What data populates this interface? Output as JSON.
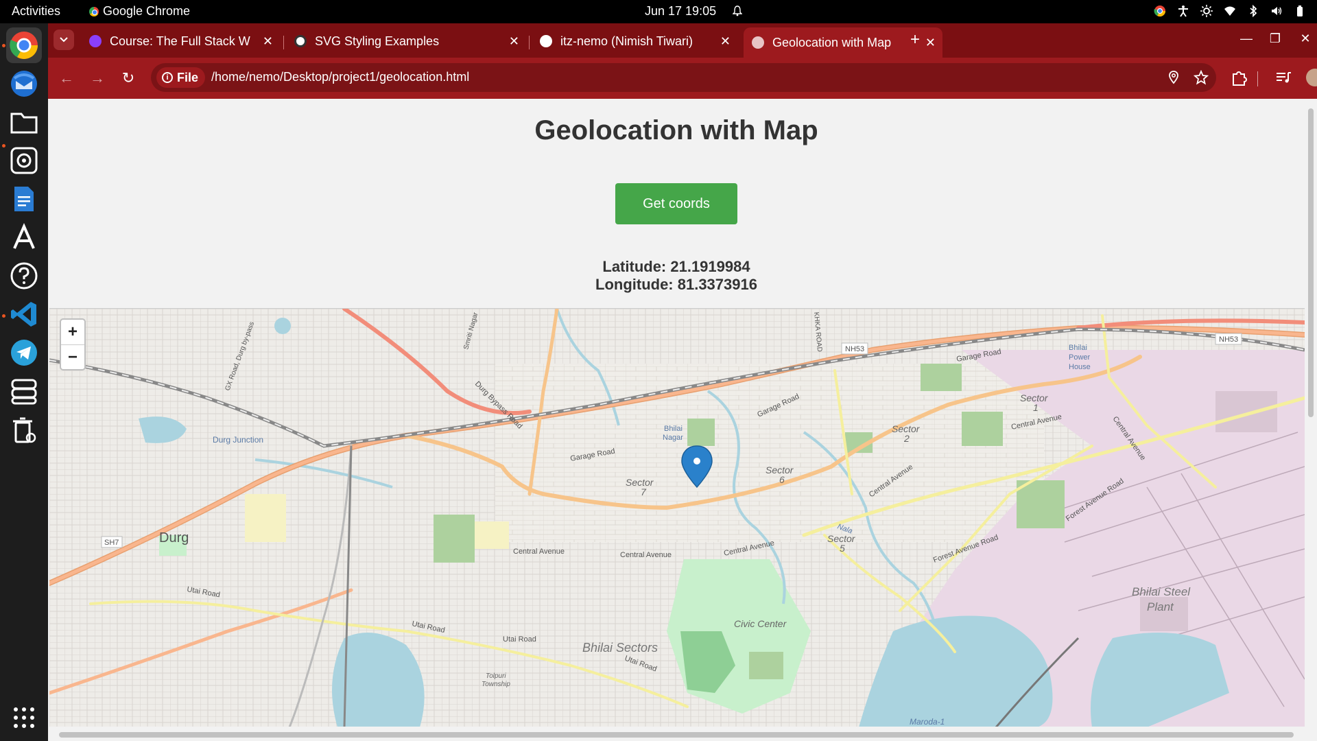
{
  "system": {
    "activities": "Activities",
    "app_name": "Google Chrome",
    "clock": "Jun 17  19:05"
  },
  "dock": {
    "items": [
      "google-chrome",
      "thunderbird",
      "files",
      "rhythmbox",
      "libreoffice-writer",
      "app-center",
      "help",
      "vscode",
      "telegram",
      "storage",
      "trash",
      "show-apps"
    ]
  },
  "tabs": [
    {
      "title": "Course: The Full Stack W",
      "favicon_color": "#8a3ffc"
    },
    {
      "title": "SVG Styling Examples",
      "favicon_color": "#ffffff"
    },
    {
      "title": "itz-nemo (Nimish Tiwari)",
      "favicon_color": "#ffffff"
    },
    {
      "title": "Geolocation with Map",
      "favicon_color": "#ffffff",
      "active": true
    }
  ],
  "omnibox": {
    "scheme_label": "File",
    "url": "/home/nemo/Desktop/project1/geolocation.html"
  },
  "page": {
    "title": "Geolocation with Map",
    "button": "Get coords",
    "latitude": "Latitude: 21.1919984",
    "longitude": "Longitude: 81.3373916"
  },
  "map": {
    "zoom_in": "+",
    "zoom_out": "−",
    "labels": {
      "durg": "Durg",
      "durg_junction": "Durg Junction",
      "bhilai_nagar_1": "Bhilai",
      "bhilai_nagar_2": "Nagar",
      "sector7": "Sector",
      "sector7n": "7",
      "sector6": "Sector",
      "sector6n": "6",
      "sector5": "Sector",
      "sector5n": "5",
      "sector2": "Sector",
      "sector2n": "2",
      "sector1": "Sector",
      "sector1n": "1",
      "central_avenue_1": "Central Avenue",
      "central_avenue_2": "Central Avenue",
      "central_avenue_3": "Central Avenue",
      "central_avenue_4": "Central Avenue",
      "central_avenue_5": "Central Avenue",
      "central_avenue_6": "Central Avenue",
      "garage_road_1": "Garage Road",
      "garage_road_2": "Garage Road",
      "garage_road_3": "Garage Road",
      "utai_road_1": "Utai Road",
      "utai_road_2": "Utai Road",
      "utai_road_3": "Utai Road",
      "utai_road_4": "Utai Road",
      "forest_avenue_road_1": "Forest Avenue Road",
      "forest_avenue_road_2": "Forest Avenue Road",
      "durg_bypass": "Durg Bypass Road",
      "civic_center": "Civic Center",
      "bhilai_sectors": "Bhilai Sectors",
      "bhilai_steel_1": "Bhilai Steel",
      "bhilai_steel_2": "Plant",
      "bhilai_power_1": "Bhilai",
      "bhilai_power_2": "Power",
      "bhilai_power_3": "House",
      "nh53_a": "NH53",
      "nh53_b": "NH53",
      "sh7": "SH7",
      "tolpuri_1": "Tolpuri",
      "tolpuri_2": "Township",
      "maroda": "Maroda-1",
      "nala": "Nala",
      "gx_road": "GX Road, Durg by-pass",
      "smriti_nagar": "Smriti Nagar",
      "khka_road": "KHKA ROAD"
    }
  }
}
